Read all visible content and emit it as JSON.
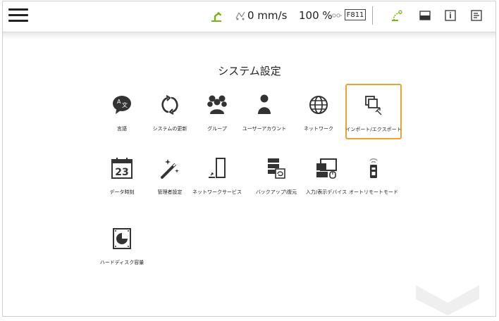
{
  "header": {
    "speed_text": "0 mm/s",
    "percent_text": "100 %",
    "frame_label": "F811"
  },
  "main": {
    "title": "システム設定",
    "tiles": [
      {
        "label": "言語",
        "icon": "language-icon"
      },
      {
        "label": "システムの更新",
        "icon": "update-icon"
      },
      {
        "label": "グループ",
        "icon": "group-icon"
      },
      {
        "label": "ユーザーアカウント",
        "icon": "user-account-icon"
      },
      {
        "label": "ネットワーク",
        "icon": "network-icon"
      },
      {
        "label": "インポート/エクスポート",
        "icon": "import-export-icon",
        "selected": true
      },
      {
        "label": "データ時刻",
        "icon": "calendar-icon"
      },
      {
        "label": "管理者設定",
        "icon": "admin-wand-icon"
      },
      {
        "label": "ネットワークサービス",
        "icon": "network-service-icon"
      },
      {
        "label": "バックアップ\\復元",
        "icon": "backup-restore-icon"
      },
      {
        "label": "入力/表示デバイス",
        "icon": "io-device-icon"
      },
      {
        "label": "オートリモートモード",
        "icon": "remote-mode-icon"
      },
      {
        "label": "ハードディスク容量",
        "icon": "hard-disk-icon"
      }
    ]
  },
  "colors": {
    "selection_border": "#f0a030",
    "robot_green": "#7ab317"
  }
}
